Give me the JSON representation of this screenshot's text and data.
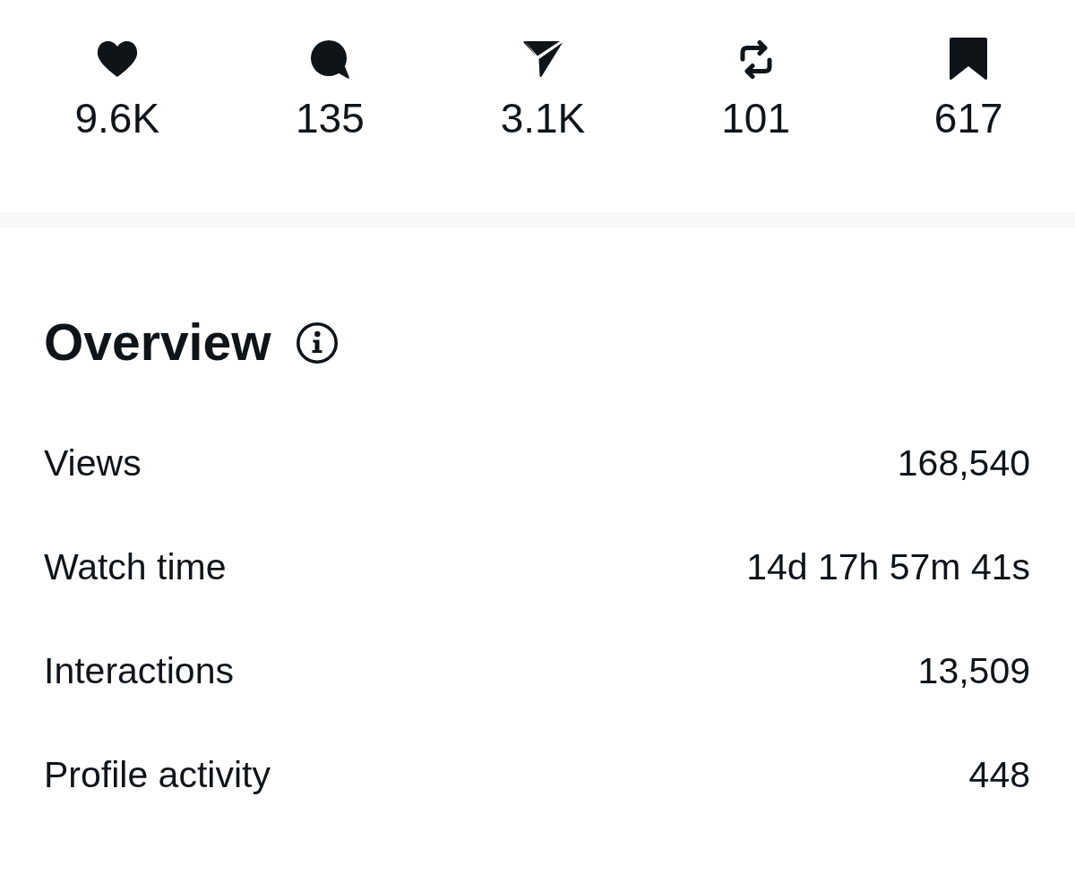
{
  "engagement": [
    {
      "kind": "like",
      "count": "9.6K"
    },
    {
      "kind": "reply",
      "count": "135"
    },
    {
      "kind": "share",
      "count": "3.1K"
    },
    {
      "kind": "repost",
      "count": "101"
    },
    {
      "kind": "bookmark",
      "count": "617"
    }
  ],
  "overview": {
    "title": "Overview",
    "rows": [
      {
        "label": "Views",
        "value": "168,540"
      },
      {
        "label": "Watch time",
        "value": "14d 17h 57m 41s"
      },
      {
        "label": "Interactions",
        "value": "13,509"
      },
      {
        "label": "Profile activity",
        "value": "448"
      }
    ]
  }
}
